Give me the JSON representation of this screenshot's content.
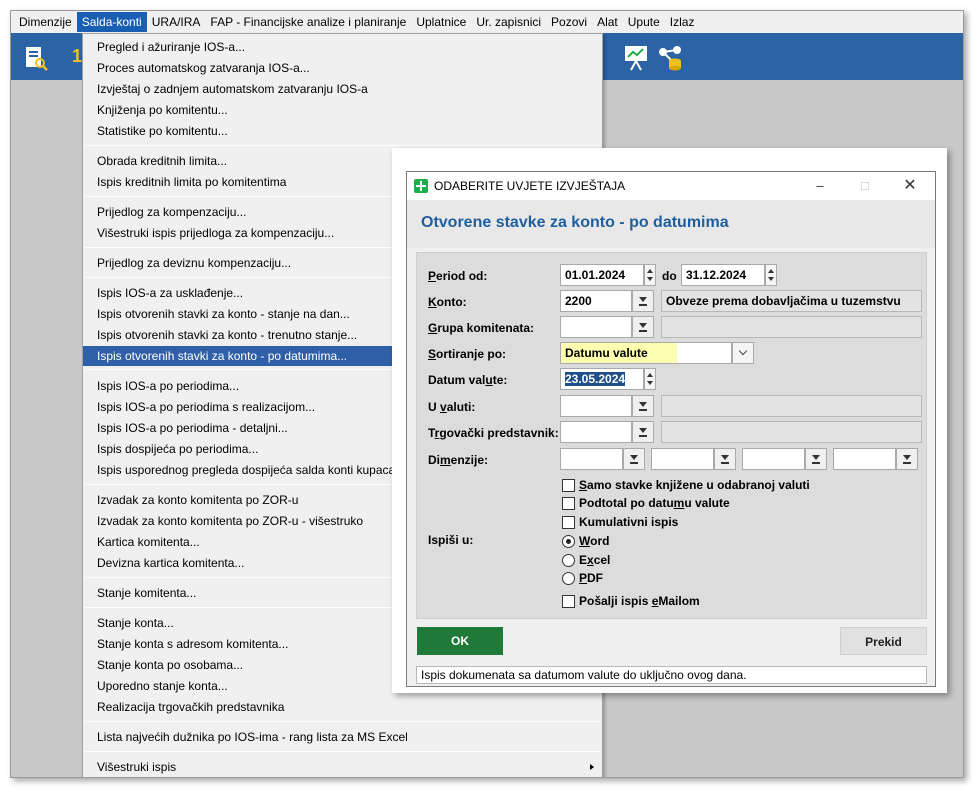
{
  "menubar": {
    "items": [
      "Dimenzije",
      "Salda-konti",
      "URA/IRA",
      "FAP - Financijske analize i planiranje",
      "Uplatnice",
      "Ur. zapisnici",
      "Pozovi",
      "Alat",
      "Upute",
      "Izlaz"
    ],
    "active_index": 1
  },
  "toolbar": {
    "partial_glyph": "1"
  },
  "dropdown": {
    "items": [
      "Pregled i ažuriranje IOS-a...",
      "Proces automatskog zatvaranja IOS-a...",
      "Izvještaj o zadnjem automatskom zatvaranju IOS-a",
      "Knjiženja po komitentu...",
      "Statistike po komitentu...",
      "Obrada kreditnih limita...",
      "Ispis kreditnih limita po komitentima",
      "Prijedlog za kompenzaciju...",
      "Višestruki ispis prijedloga za kompenzaciju...",
      "Prijedlog za deviznu kompenzaciju...",
      "Ispis IOS-a za usklađenje...",
      "Ispis otvorenih stavki za konto - stanje na dan...",
      "Ispis otvorenih stavki za konto - trenutno stanje...",
      "Ispis otvorenih stavki za konto - po datumima...",
      "Ispis IOS-a po periodima...",
      "Ispis IOS-a po periodima s realizacijom...",
      "Ispis IOS-a po periodima - detaljni...",
      "Ispis dospijeća po periodima...",
      "Ispis usporednog pregleda dospijeća salda konti kupaca",
      "Izvadak za konto komitenta po ZOR-u",
      "Izvadak za konto komitenta po ZOR-u - višestruko",
      "Kartica komitenta...",
      "Devizna kartica komitenta...",
      "Stanje komitenta...",
      "Stanje konta...",
      "Stanje konta s adresom komitenta...",
      "Stanje konta po osobama...",
      "Uporedno stanje konta...",
      "Realizacija trgovačkih predstavnika",
      "Lista najvećih dužnika po IOS-ima - rang lista za MS Excel",
      "Višestruki ispis"
    ],
    "selected_index": 13
  },
  "dialog": {
    "window_title": "ODABERITE UVJETE IZVJEŠTAJA",
    "heading": "Otvorene stavke za konto - po datumima",
    "labels": {
      "period_od": "Period od:",
      "do": "do",
      "konto": "Konto:",
      "grupa": "Grupa komitenata:",
      "sortiranje": "Sortiranje po:",
      "datum_valute": "Datum valute:",
      "u_valuti": "U valuti:",
      "predstavnik": "Trgovački predstavnik:",
      "dimenzije": "Dimenzije:",
      "ispisi_u": "Ispiši u:"
    },
    "values": {
      "period_from": "01.01.2024",
      "period_to": "31.12.2024",
      "konto": "2200",
      "konto_desc": "Obveze prema dobavljačima u tuzemstvu",
      "grupa": "",
      "sortiranje": "Datumu valute",
      "datum_valute": "23.05.2024",
      "u_valuti": "",
      "predstavnik": ""
    },
    "options": {
      "samo_stavke": "Samo stavke knjižene u odabranoj valuti",
      "podtotal": "Podtotal po datumu valute",
      "kumulativni": "Kumulativni ispis",
      "word": "Word",
      "excel": "Excel",
      "pdf": "PDF",
      "email": "Pošalji ispis eMailom"
    },
    "buttons": {
      "ok": "OK",
      "cancel": "Prekid"
    },
    "status": "Ispis dokumenata sa datumom valute do uključno ovog dana."
  },
  "colors": {
    "accent": "#2b63a5",
    "ok_button": "#1f7a3a",
    "heading": "#1f5f9e",
    "highlight": "#fefeb0"
  }
}
